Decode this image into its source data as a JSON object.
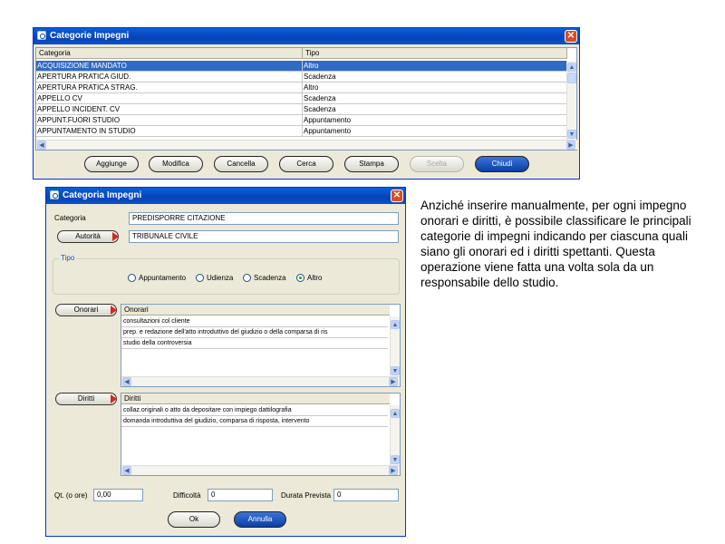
{
  "win1": {
    "title": "Categorie Impegni",
    "columns": [
      "Categoria",
      "Tipo"
    ],
    "rows": [
      {
        "categoria": "ACQUISIZIONE MANDATO",
        "tipo": "Altro"
      },
      {
        "categoria": "APERTURA PRATICA GIUD.",
        "tipo": "Scadenza"
      },
      {
        "categoria": "APERTURA PRATICA STRAG.",
        "tipo": "Altro"
      },
      {
        "categoria": "APPELLO CV",
        "tipo": "Scadenza"
      },
      {
        "categoria": "APPELLO INCIDENT. CV",
        "tipo": "Scadenza"
      },
      {
        "categoria": "APPUNT.FUORI STUDIO",
        "tipo": "Appuntamento"
      },
      {
        "categoria": "APPUNTAMENTO IN STUDIO",
        "tipo": "Appuntamento"
      }
    ],
    "buttons": {
      "aggiunge": "Aggiunge",
      "modifica": "Modifica",
      "cancella": "Cancella",
      "cerca": "Cerca",
      "stampa": "Stampa",
      "scelta": "Scelta",
      "chiudi": "Chiudi"
    }
  },
  "win2": {
    "title": "Categoria Impegni",
    "categoria_label": "Categoria",
    "categoria_value": "PREDISPORRE CITAZIONE",
    "autorita_button": "Autorità",
    "autorita_value": "TRIBUNALE CIVILE",
    "tipo_label": "Tipo",
    "tipo_options": [
      "Appuntamento",
      "Udienza",
      "Scadenza",
      "Altro"
    ],
    "tipo_selected": "Altro",
    "onorari_button": "Onorari",
    "onorari_header": "Onorari",
    "onorari_items": [
      "consultazioni col cliente",
      "prep. e redazione dell'atto introduttivo del giudizio o della comparsa di ris",
      "studio della controversia"
    ],
    "diritti_button": "Diritti",
    "diritti_header": "Diritti",
    "diritti_items": [
      "collaz.originali o atto da depositare con impiego dattilografia",
      "domanda introduttiva del giudizio, comparsa di risposta, intervento"
    ],
    "qt_label": "Qt. (o ore)",
    "qt_value": "0,00",
    "difficolta_label": "Difficoltà",
    "difficolta_value": "0",
    "durata_label": "Durata Prevista",
    "durata_value": "0",
    "ok_button": "Ok",
    "annulla_button": "Annulla"
  },
  "description": "Anziché inserire manualmente, per ogni impegno onorari e diritti, è possibile classificare le principali categorie di impegni indicando per ciascuna quali siano gli onorari ed i diritti spettanti. Questa operazione viene fatta una volta sola da un responsabile dello studio.",
  "colors": {
    "titlebar": "#0842b8",
    "selection": "#316ac5",
    "window_bg": "#ece9d8",
    "close": "#e04a22",
    "arrow_red": "#d9261c"
  }
}
